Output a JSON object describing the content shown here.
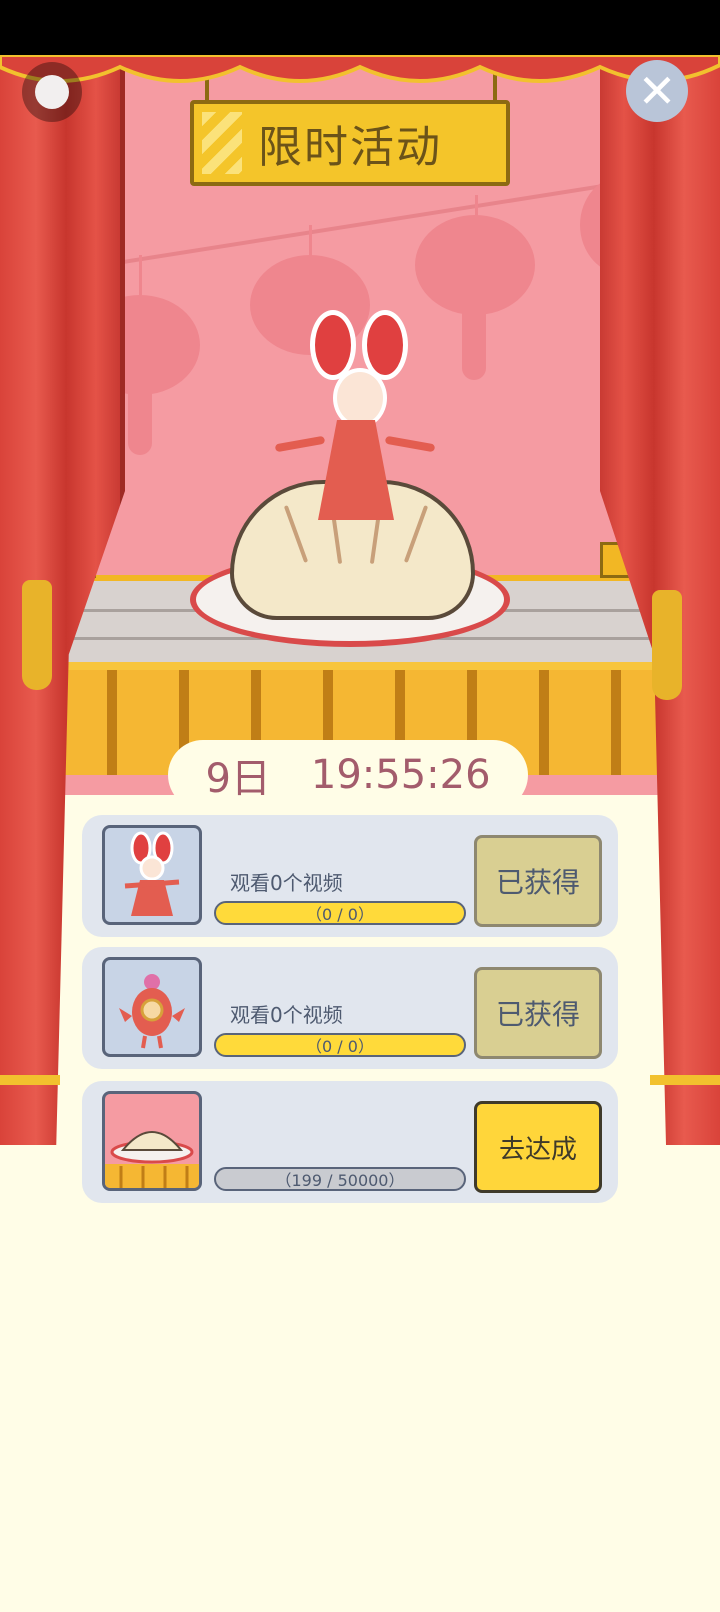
{
  "header": {
    "title": "限时活动"
  },
  "timer": {
    "days": "9日",
    "time": "19:55:26"
  },
  "tasks": [
    {
      "label": "观看0个视频",
      "progress_text": "（0 / 0）",
      "button_label": "已获得",
      "thumb_icon": "rabbit-girl-costume-icon"
    },
    {
      "label": "观看0个视频",
      "progress_text": "（0 / 0）",
      "button_label": "已获得",
      "thumb_icon": "koi-fish-costume-icon"
    },
    {
      "label": "",
      "progress_text": "（199 / 50000）",
      "progress_value": 0.00398,
      "button_label": "去达成",
      "thumb_icon": "dumpling-stage-icon"
    }
  ],
  "icons": {
    "menu": "menu-dot-icon",
    "close": "close-icon"
  },
  "colors": {
    "stage_bg": "#F59BA2",
    "curtain": "#D9433A",
    "sign": "#F4C52A",
    "timer_text": "#A35C6C",
    "progress_fill": "#FFDA3A",
    "button_active": "#FFD63A",
    "button_claimed": "#D9CF92"
  }
}
